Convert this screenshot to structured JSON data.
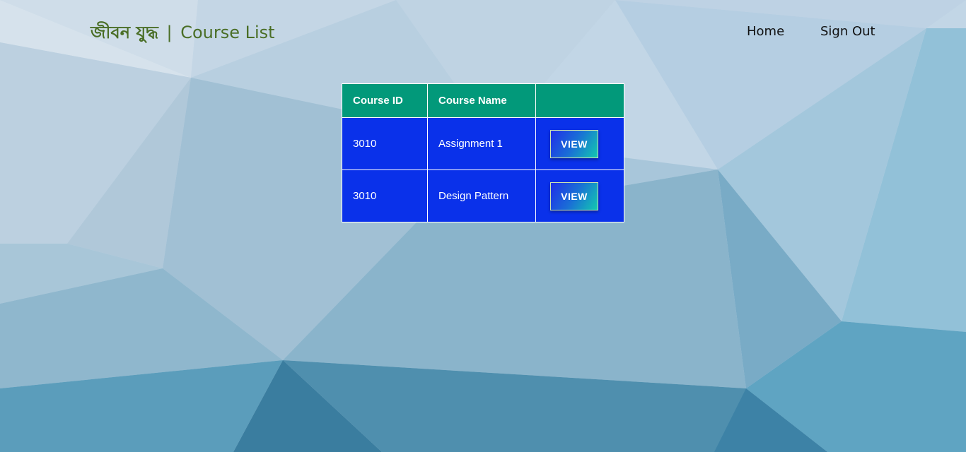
{
  "header": {
    "brand_bengali": "জীবন যুদ্ধ",
    "brand_separator": "|",
    "page_title": "Course List",
    "nav": [
      {
        "label": "Home"
      },
      {
        "label": "Sign Out"
      }
    ]
  },
  "table": {
    "columns": [
      "Course ID",
      "Course Name",
      ""
    ],
    "rows": [
      {
        "course_id": "3010",
        "course_name": "Assignment 1",
        "action_label": "VIEW"
      },
      {
        "course_id": "3010",
        "course_name": "Design Pattern",
        "action_label": "VIEW"
      }
    ]
  },
  "colors": {
    "brand_text": "#4a6e26",
    "table_header": "#02997a",
    "table_body": "#0a31ea",
    "background": "#bcd2e3"
  }
}
